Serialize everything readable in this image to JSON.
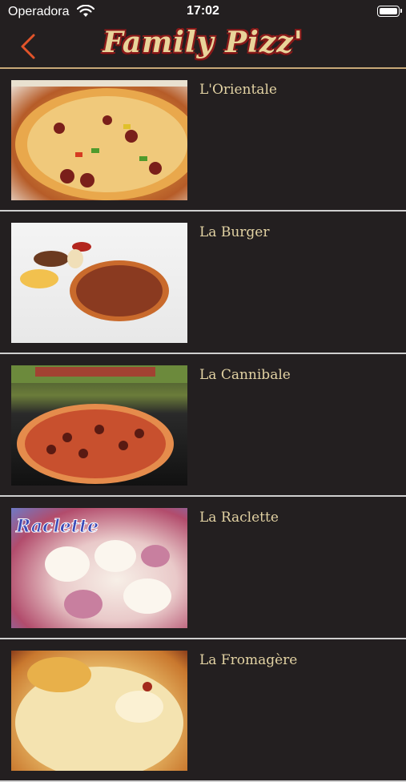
{
  "status": {
    "carrier": "Operadora",
    "time": "17:02"
  },
  "nav": {
    "logo": "Family Pizz'"
  },
  "items": [
    {
      "title": "L'Orientale"
    },
    {
      "title": "La Burger"
    },
    {
      "title": "La Cannibale"
    },
    {
      "title": "La Raclette"
    },
    {
      "title": "La Fromagère"
    }
  ],
  "colors": {
    "background": "#231f20",
    "accent": "#c8a878",
    "title_text": "#e2d2a3",
    "back_chevron": "#e2542a"
  }
}
